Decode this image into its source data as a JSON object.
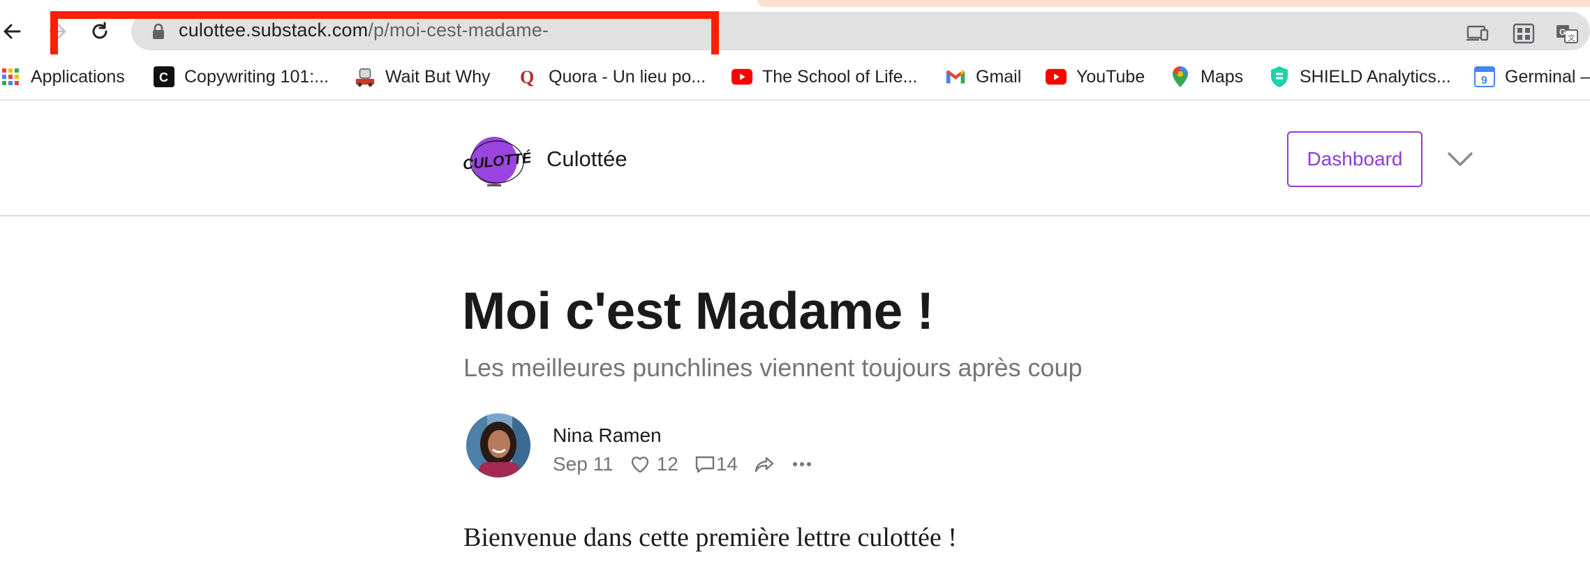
{
  "browser": {
    "url_host": "culottee.substack.com",
    "url_path": "/p/moi-cest-madame-",
    "bookmarks": [
      {
        "label": "Applications",
        "icon": "apps-grid-icon"
      },
      {
        "label": "Copywriting 101:...",
        "icon": "copywriting-c-icon"
      },
      {
        "label": "Wait But Why",
        "icon": "wait-but-why-icon"
      },
      {
        "label": "Quora - Un lieu po...",
        "icon": "quora-icon"
      },
      {
        "label": "The School of Life...",
        "icon": "youtube-icon"
      },
      {
        "label": "Gmail",
        "icon": "gmail-icon"
      },
      {
        "label": "YouTube",
        "icon": "youtube-icon"
      },
      {
        "label": "Maps",
        "icon": "maps-pin-icon"
      },
      {
        "label": "SHIELD Analytics...",
        "icon": "shield-icon"
      },
      {
        "label": "Germinal –",
        "icon": "calendar-icon"
      }
    ]
  },
  "header": {
    "publication_name": "Culottée",
    "logo_text": "CULOTTÉE",
    "dashboard_label": "Dashboard"
  },
  "article": {
    "title": "Moi c'est Madame !",
    "subtitle": "Les meilleures punchlines viennent toujours après coup",
    "author": "Nina Ramen",
    "date": "Sep 11",
    "likes": "12",
    "comments": "14",
    "body_first_line": "Bienvenue dans cette première lettre culottée !"
  },
  "colors": {
    "accent": "#8d3bd8",
    "highlight_box": "#ff1e00",
    "omnibox_bg": "#e1e1e1",
    "subtitle": "#757575"
  }
}
